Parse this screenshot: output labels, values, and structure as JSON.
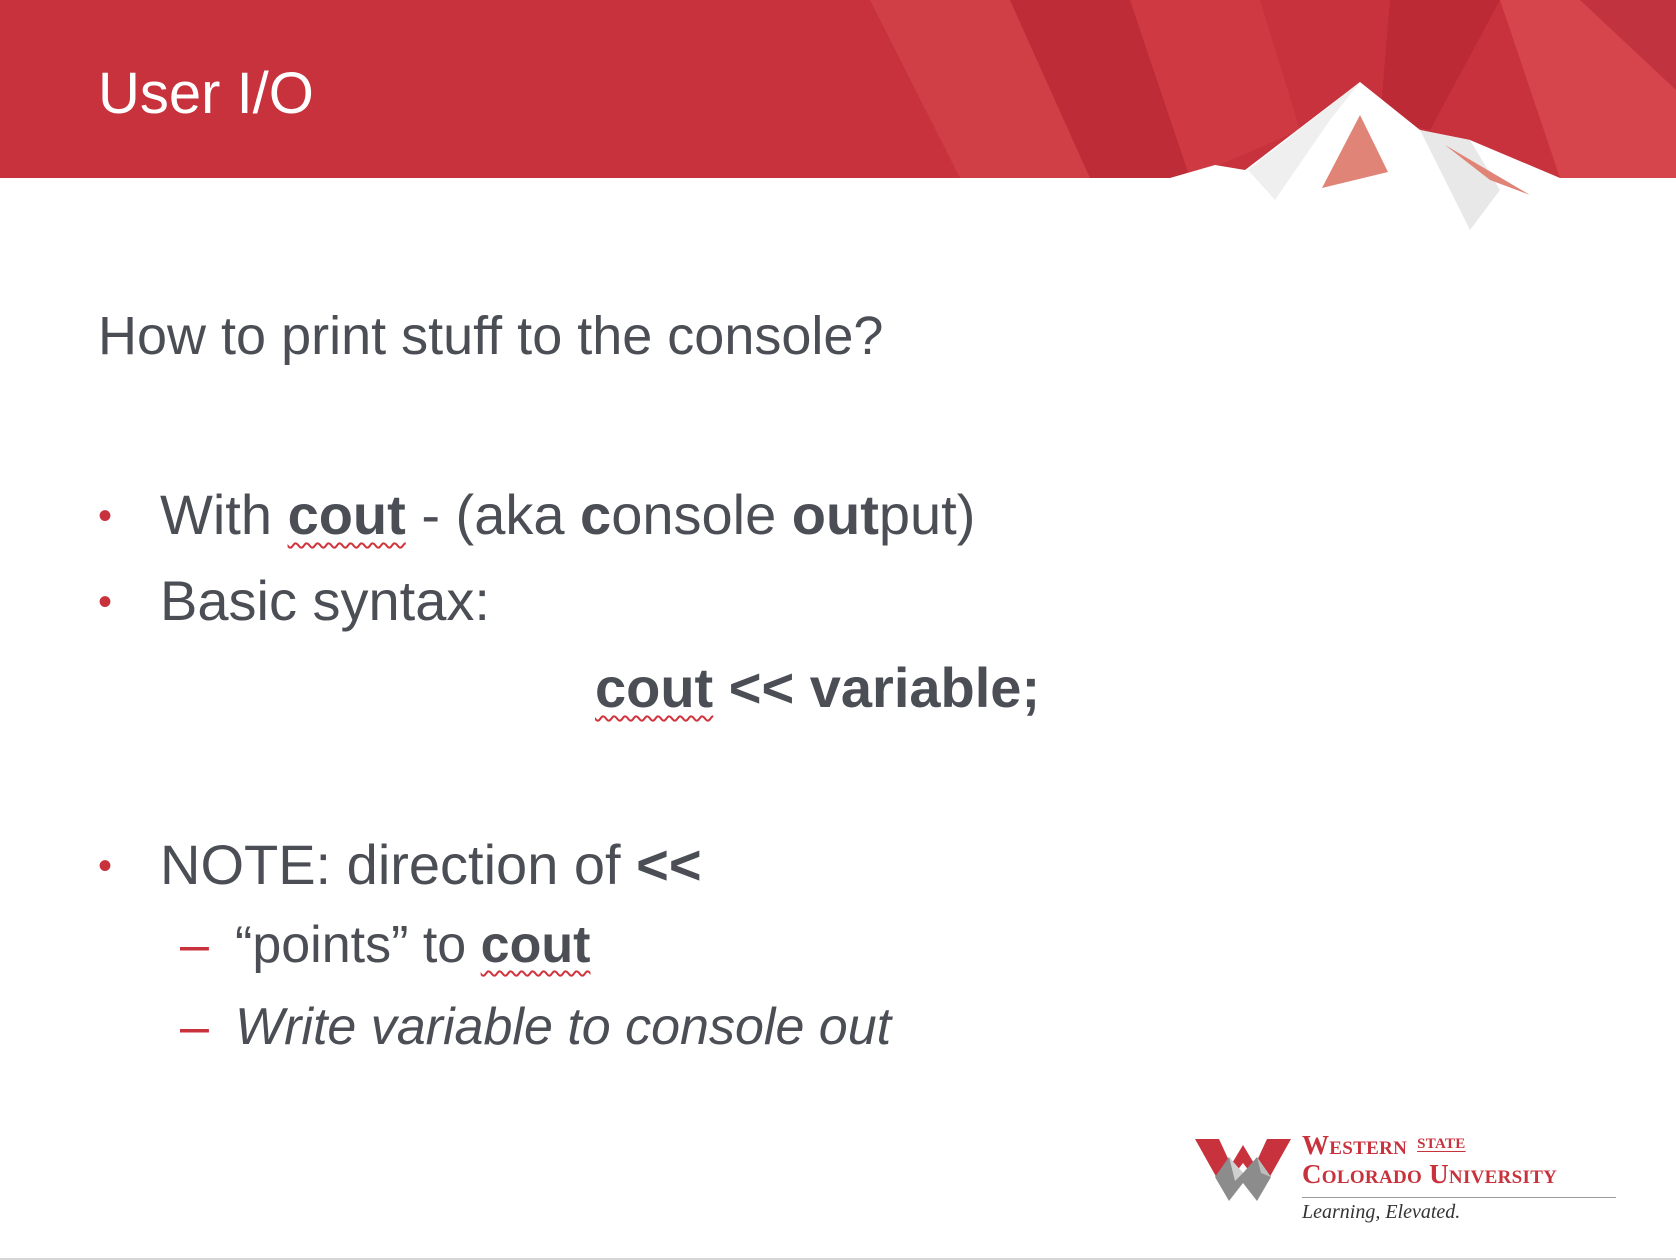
{
  "slide": {
    "title": "User I/O",
    "subtitle": "How to print stuff to the console?",
    "bullets": [
      {
        "parts": [
          "With ",
          "cout",
          " - (aka ",
          "c",
          "onsole ",
          "out",
          "put)"
        ]
      },
      {
        "text": "Basic syntax:"
      },
      {
        "parts": [
          "NOTE: direction of ",
          "<<"
        ]
      }
    ],
    "syntax": {
      "keyword": "cout",
      "rest": " << variable;"
    },
    "sub_bullets": [
      {
        "dash": "–",
        "parts": [
          "“points” to ",
          "cout"
        ]
      },
      {
        "dash": "–",
        "text": "Write variable to console out"
      }
    ],
    "bullet_symbol": "•"
  },
  "logo": {
    "line1": "Western",
    "state": "STATE",
    "line2": "Colorado University",
    "tagline": "Learning, Elevated.",
    "icon": "mountain-w-icon"
  },
  "colors": {
    "brand_red": "#c8323c",
    "text_gray": "#4b4f55"
  }
}
